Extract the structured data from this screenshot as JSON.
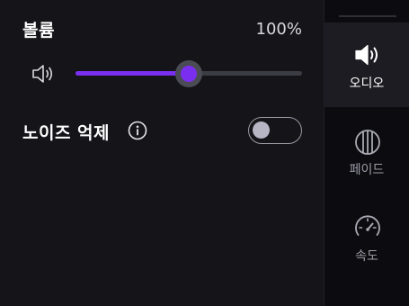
{
  "volume": {
    "title": "볼륨",
    "value_text": "100%",
    "slider_level": 0.5
  },
  "noise_suppression": {
    "label": "노이즈 억제",
    "enabled": false
  },
  "sidebar": {
    "items": [
      {
        "label": "오디오",
        "icon": "speaker-icon",
        "active": true
      },
      {
        "label": "페이드",
        "icon": "fade-icon",
        "active": false
      },
      {
        "label": "속도",
        "icon": "speedometer-icon",
        "active": false
      }
    ]
  },
  "colors": {
    "accent": "#7a2ff0",
    "background": "#141419",
    "sidebar_background": "#0b0b10",
    "active_item_background": "#1c1c22"
  }
}
